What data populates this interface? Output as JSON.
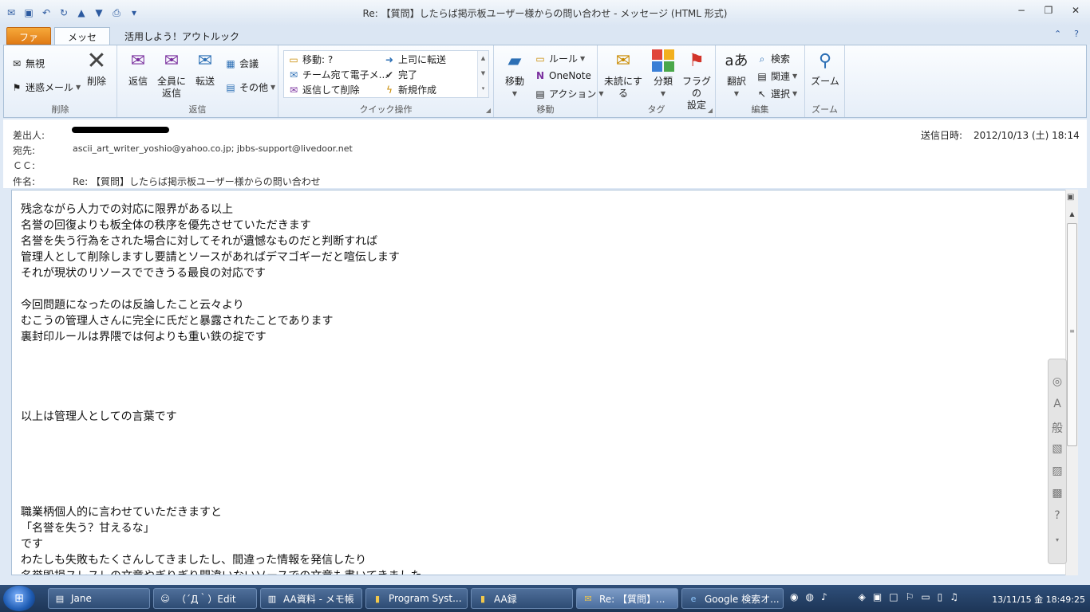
{
  "window": {
    "title": "Re: 【質問】したらば掲示板ユーザー様からの問い合わせ - メッセージ (HTML 形式)",
    "minimize": "−",
    "restore": "❐",
    "close": "✕"
  },
  "tabs": {
    "file": "ファイル",
    "message": "メッセージ",
    "extra": "活用しよう！アウトルック"
  },
  "ribbon": {
    "delete_group": {
      "label": "削除",
      "ignore": "無視",
      "junk": "迷惑メール",
      "delete": "削除"
    },
    "reply_group": {
      "label": "返信",
      "reply": "返信",
      "reply_all_line1": "全員に",
      "reply_all_line2": "返信",
      "forward": "転送",
      "meeting": "会議",
      "more": "その他"
    },
    "quick_steps": {
      "label": "クイック操作",
      "items": [
        "移動: ?",
        "チーム宛て電子メ...",
        "返信して削除",
        "上司に転送",
        "完了",
        "新規作成"
      ]
    },
    "move_group": {
      "label": "移動",
      "move": "移動",
      "rules": "ルール",
      "onenote": "OneNote",
      "actions": "アクション"
    },
    "tags_group": {
      "label": "タグ",
      "unread": "未読にする",
      "categorize": "分類",
      "flag_line1": "フラグの",
      "flag_line2": "設定"
    },
    "edit_group": {
      "label": "編集",
      "translate": "翻訳",
      "find": "検索",
      "related": "関連",
      "select": "選択"
    },
    "zoom_group": {
      "label": "ズーム",
      "zoom": "ズーム"
    }
  },
  "header": {
    "from_label": "差出人:",
    "to_label": "宛先:",
    "to_value": "ascii_art_writer_yoshio@yahoo.co.jp; jbbs-support@livedoor.net",
    "cc_label": "ＣＣ:",
    "subject_label": "件名:",
    "subject_value": "Re: 【質問】したらば掲示板ユーザー様からの問い合わせ",
    "sent_label": "送信日時:",
    "sent_value": "2012/10/13 (土) 18:14"
  },
  "body_lines": [
    "残念ながら人力での対応に限界がある以上",
    "名誉の回復よりも板全体の秩序を優先させていただきます",
    "名誉を失う行為をされた場合に対してそれが遺憾なものだと判断すれば",
    "管理人として削除しますし要請とソースがあればデマゴギーだと喧伝します",
    "それが現状のリソースでできうる最良の対応です",
    "",
    "今回問題になったのは反論したこと云々より",
    "むこうの管理人さんに完全に氏だと暴露されたことであります",
    "裏封印ルールは界隈では何よりも重い鉄の掟です",
    "",
    "",
    "",
    "",
    "以上は管理人としての言葉です",
    "",
    "",
    "",
    "",
    "",
    "職業柄個人的に言わせていただきますと",
    "「名誉を失う？甘えるな」",
    "です",
    "わたしも失敗もたくさんしてきましたし、間違った情報を発信したり",
    "名誉毀損スレスレの文章やぎりぎり間違いないソースでの文章も書いてきました"
  ],
  "ime": {
    "a": "A",
    "general": "般"
  },
  "taskbar": {
    "items": [
      {
        "label": "Jane"
      },
      {
        "label": "（´Д｀）Edit"
      },
      {
        "label": "AA資料 - メモ帳"
      },
      {
        "label": "Program Syst..."
      },
      {
        "label": "AA録"
      },
      {
        "label": "Re: 【質問】..."
      },
      {
        "label": "Google 検索オ..."
      }
    ],
    "clock": "13/11/15 金  18:49:25"
  }
}
